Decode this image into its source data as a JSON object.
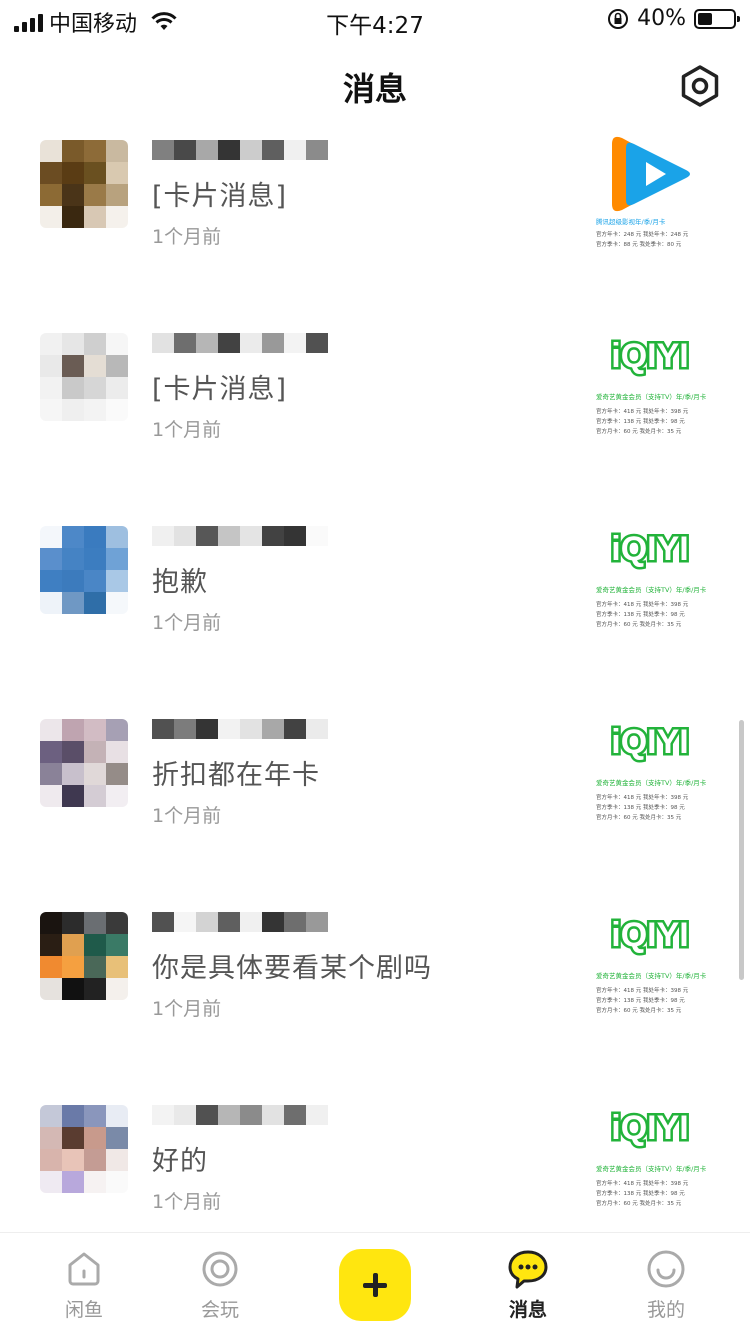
{
  "status_bar": {
    "carrier": "中国移动",
    "time": "下午4:27",
    "battery_percent": "40%",
    "battery_level": 0.4
  },
  "header": {
    "title": "消息"
  },
  "messages": [
    {
      "preview": "[卡片消息]",
      "time": "1个月前",
      "thumb": "tencent-video",
      "thumb_caption": "腾讯超级影视年/季/月卡",
      "thumb_lines": [
        "官方年卡：248 元   我处年卡：248 元",
        "官方季卡：88 元   我处季卡：80 元"
      ]
    },
    {
      "preview": "[卡片消息]",
      "time": "1个月前",
      "thumb": "iqiyi",
      "thumb_caption": "爱奇艺黄金会员（支持TV）年/季/月卡",
      "thumb_lines": [
        "官方年卡：418 元   我处年卡：398 元",
        "官方季卡：138 元   我处季卡：98 元",
        "官方月卡：60 元   我处月卡：35 元"
      ]
    },
    {
      "preview": "抱歉",
      "time": "1个月前",
      "thumb": "iqiyi",
      "thumb_caption": "爱奇艺黄金会员（支持TV）年/季/月卡",
      "thumb_lines": [
        "官方年卡：418 元   我处年卡：398 元",
        "官方季卡：138 元   我处季卡：98 元",
        "官方月卡：60 元   我处月卡：35 元"
      ]
    },
    {
      "preview": "折扣都在年卡",
      "time": "1个月前",
      "thumb": "iqiyi",
      "thumb_caption": "爱奇艺黄金会员（支持TV）年/季/月卡",
      "thumb_lines": [
        "官方年卡：418 元   我处年卡：398 元",
        "官方季卡：138 元   我处季卡：98 元",
        "官方月卡：60 元   我处月卡：35 元"
      ]
    },
    {
      "preview": "你是具体要看某个剧吗",
      "time": "1个月前",
      "thumb": "iqiyi",
      "thumb_caption": "爱奇艺黄金会员（支持TV）年/季/月卡",
      "thumb_lines": [
        "官方年卡：418 元   我处年卡：398 元",
        "官方季卡：138 元   我处季卡：98 元",
        "官方月卡：60 元   我处月卡：35 元"
      ]
    },
    {
      "preview": "好的",
      "time": "1个月前",
      "thumb": "iqiyi",
      "thumb_caption": "爱奇艺黄金会员（支持TV）年/季/月卡",
      "thumb_lines": [
        "官方年卡：418 元   我处年卡：398 元",
        "官方季卡：138 元   我处季卡：98 元",
        "官方月卡：60 元   我处月卡：35 元"
      ]
    }
  ],
  "iqiyi_logo_text": "iQIYI",
  "tabbar": {
    "tabs": [
      {
        "label": "闲鱼",
        "icon": "home-icon"
      },
      {
        "label": "会玩",
        "icon": "target-icon"
      },
      {
        "label": "",
        "icon": "plus-icon"
      },
      {
        "label": "消息",
        "icon": "chat-bubble-icon",
        "active": true
      },
      {
        "label": "我的",
        "icon": "smile-icon"
      }
    ]
  },
  "colors": {
    "accent_yellow": "#ffe60f",
    "iqiyi_green": "#22b33a",
    "tencent_blue": "#1aa3e8",
    "tencent_orange": "#ff8a00"
  }
}
